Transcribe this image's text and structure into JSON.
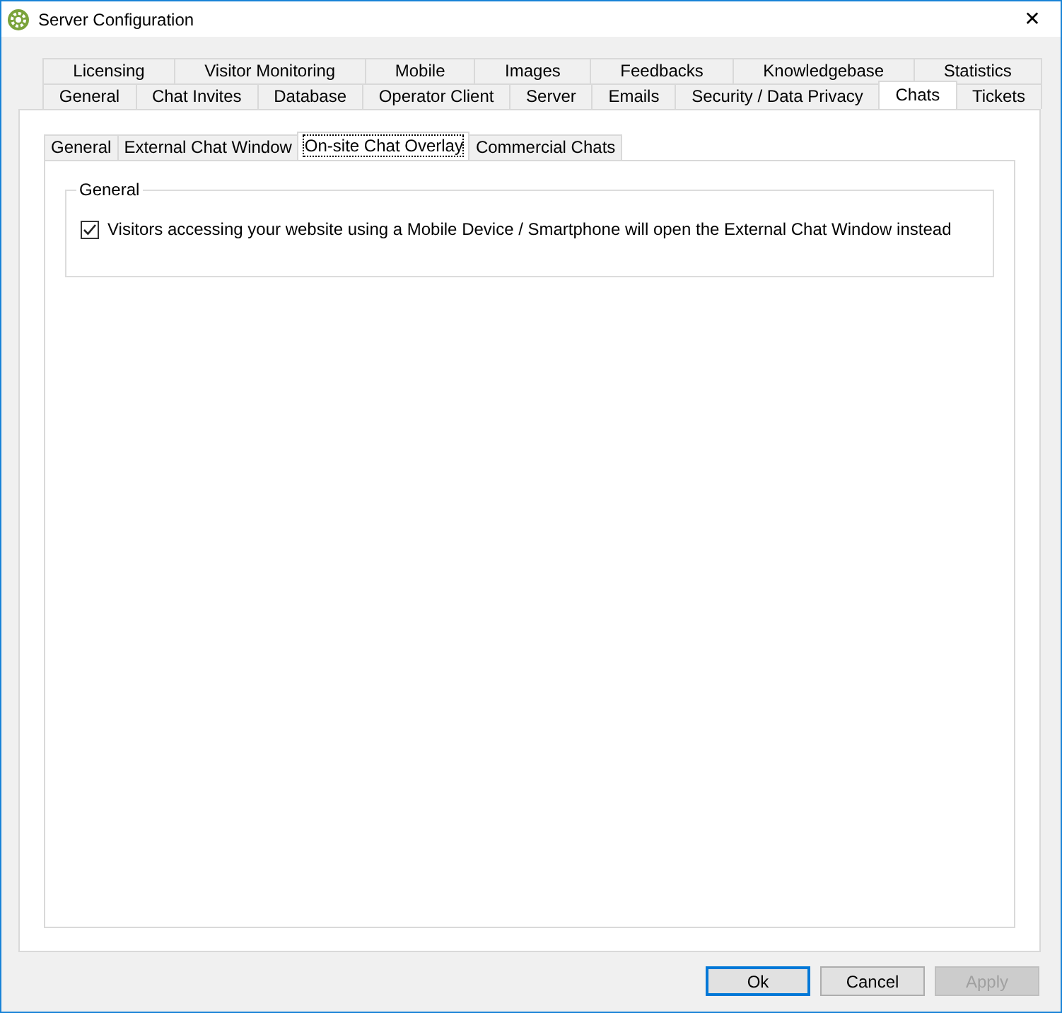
{
  "window": {
    "title": "Server Configuration",
    "close": "✕"
  },
  "tabs_row_1": [
    {
      "label": "Licensing",
      "selected": false
    },
    {
      "label": "Visitor Monitoring",
      "selected": false
    },
    {
      "label": "Mobile",
      "selected": false
    },
    {
      "label": "Images",
      "selected": false
    },
    {
      "label": "Feedbacks",
      "selected": false
    },
    {
      "label": "Knowledgebase",
      "selected": false
    },
    {
      "label": "Statistics",
      "selected": false
    }
  ],
  "tabs_row_2": [
    {
      "label": "General",
      "selected": false
    },
    {
      "label": "Chat Invites",
      "selected": false
    },
    {
      "label": "Database",
      "selected": false
    },
    {
      "label": "Operator Client",
      "selected": false
    },
    {
      "label": "Server",
      "selected": false
    },
    {
      "label": "Emails",
      "selected": false
    },
    {
      "label": "Security / Data Privacy",
      "selected": false
    },
    {
      "label": "Chats",
      "selected": true
    },
    {
      "label": "Tickets",
      "selected": false
    }
  ],
  "sub_tabs": [
    {
      "label": "General",
      "selected": false
    },
    {
      "label": "External Chat Window",
      "selected": false
    },
    {
      "label": "On-site Chat Overlay",
      "selected": true
    },
    {
      "label": "Commercial Chats",
      "selected": false
    }
  ],
  "group": {
    "title": "General",
    "options": [
      {
        "label": "Visitors accessing your website using a Mobile Device / Smartphone will open the External Chat Window instead",
        "checked": true
      }
    ]
  },
  "buttons": [
    {
      "label": "Ok",
      "default": true,
      "disabled": false
    },
    {
      "label": "Cancel",
      "default": false,
      "disabled": false
    },
    {
      "label": "Apply",
      "default": false,
      "disabled": true
    }
  ]
}
